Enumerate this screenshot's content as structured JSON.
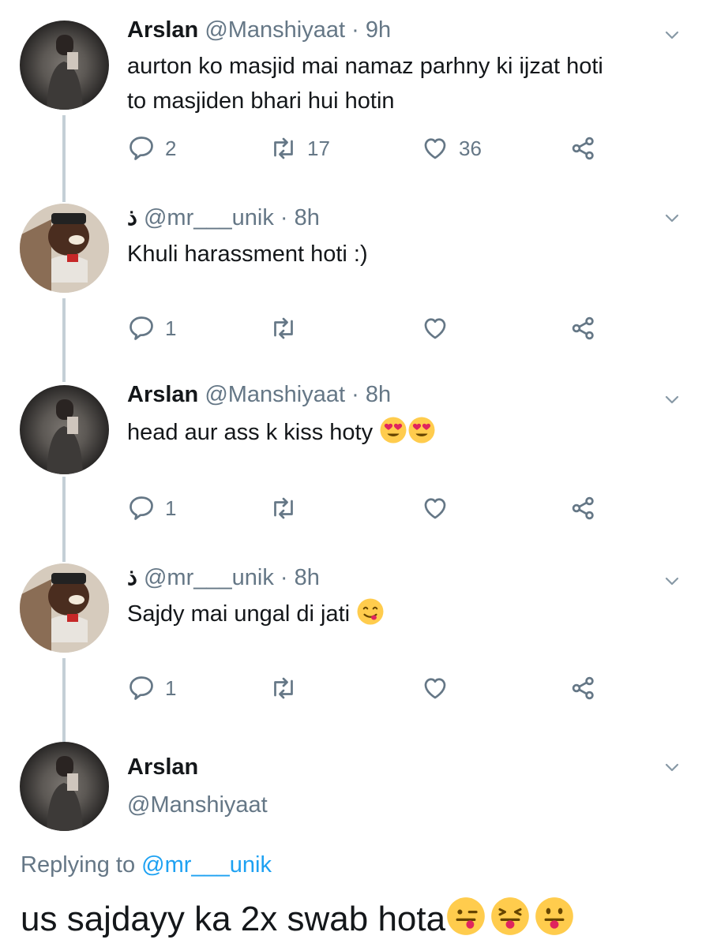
{
  "tweets": [
    {
      "name": "Arslan",
      "handle": "@Manshiyaat",
      "sep": "·",
      "time": "9h",
      "text_line1": "aurton ko masjid mai namaz parhny ki ijzat hoti",
      "text_line2": "to masjiden  bhari hui hotin",
      "replies": "2",
      "retweets": "17",
      "likes": "36"
    },
    {
      "name": "ذ",
      "handle": "@mr___unik",
      "sep": "·",
      "time": "8h",
      "text": "Khuli harassment hoti :)",
      "replies": "1"
    },
    {
      "name": "Arslan",
      "handle": "@Manshiyaat",
      "sep": "·",
      "time": "8h",
      "text": "head aur ass k kiss hoty",
      "replies": "1"
    },
    {
      "name": "ذ",
      "handle": "@mr___unik",
      "sep": "·",
      "time": "8h",
      "text": "Sajdy mai ungal di jati",
      "replies": "1"
    }
  ],
  "main_tweet": {
    "name": "Arslan",
    "handle": "@Manshiyaat",
    "replying_label": "Replying to",
    "replying_mention": "@mr___unik",
    "text": "us sajdayy ka 2x swab hota"
  },
  "icons": [
    "reply-icon",
    "retweet-icon",
    "like-icon",
    "share-icon",
    "chevron-down-icon"
  ],
  "colors": {
    "secondary": "#657786",
    "link": "#1da1f2",
    "thread": "#c4cfd6"
  }
}
